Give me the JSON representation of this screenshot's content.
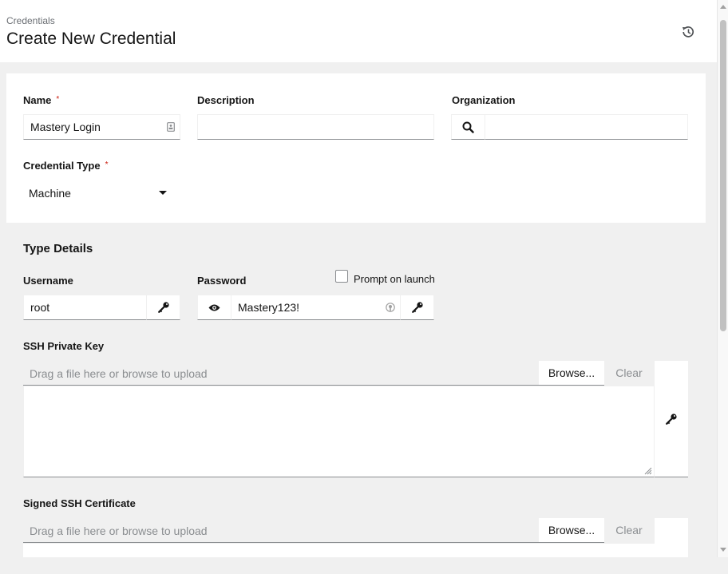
{
  "header": {
    "breadcrumb": "Credentials",
    "title": "Create New Credential"
  },
  "form": {
    "name": {
      "label": "Name",
      "required": "*",
      "value": "Mastery Login"
    },
    "description": {
      "label": "Description",
      "value": ""
    },
    "organization": {
      "label": "Organization",
      "value": ""
    },
    "credential_type": {
      "label": "Credential Type",
      "required": "*",
      "value": "Machine"
    }
  },
  "type_details": {
    "title": "Type Details",
    "username": {
      "label": "Username",
      "value": "root"
    },
    "password": {
      "label": "Password",
      "value": "Mastery123!",
      "prompt_label": "Prompt on launch",
      "prompt_checked": false
    },
    "ssh_private_key": {
      "label": "SSH Private Key",
      "placeholder": "Drag a file here or browse to upload",
      "browse_label": "Browse...",
      "clear_label": "Clear",
      "value": ""
    },
    "signed_ssh_certificate": {
      "label": "Signed SSH Certificate",
      "placeholder": "Drag a file here or browse to upload",
      "browse_label": "Browse...",
      "clear_label": "Clear"
    }
  },
  "icons": {
    "history": "history-icon",
    "search": "search-icon",
    "key": "key-icon",
    "eye": "eye-icon",
    "password_manager": "password-manager-icon"
  },
  "colors": {
    "required": "#c9190b",
    "border": "#8a8d90",
    "background": "#f0f0f0"
  }
}
